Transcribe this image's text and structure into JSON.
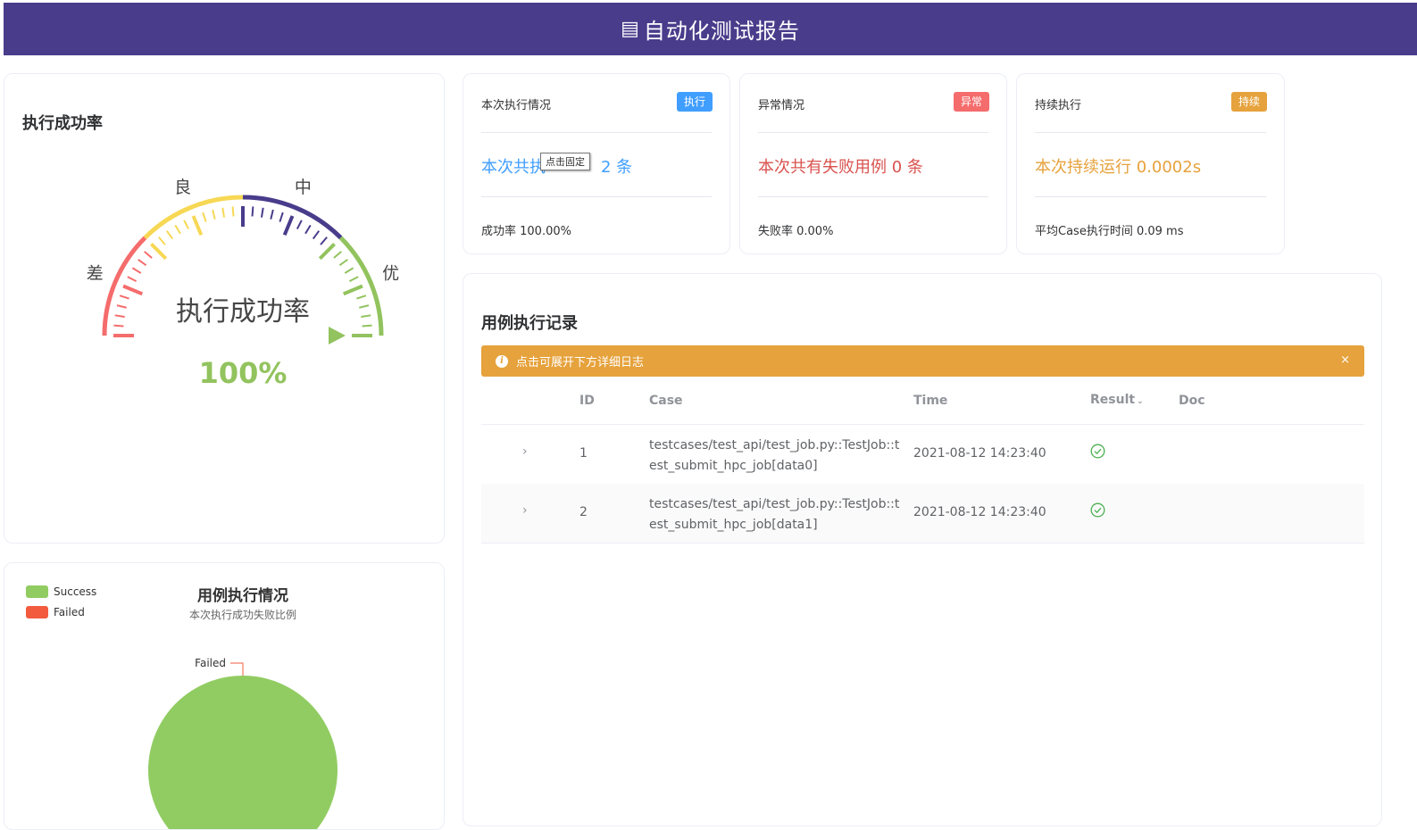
{
  "header": {
    "title": "自动化测试报告",
    "icon": "report-icon"
  },
  "gauge_card": {
    "title": "执行成功率",
    "center_label": "执行成功率",
    "value_text": "100%",
    "value_fraction": 1.0,
    "zones": {
      "poor": "差",
      "good": "良",
      "medium": "中",
      "excellent": "优"
    },
    "colors": {
      "poor": "#f56c6c",
      "good": "#f7d854",
      "medium": "#493c8b",
      "excellent": "#92c35e"
    }
  },
  "stats": [
    {
      "head": "本次执行情况",
      "tag": "执行",
      "tag_color": "#409eff",
      "main": "本次共执行用例 2 条",
      "main_visible_start": "本次共执",
      "main_visible_end": "2 条",
      "main_color": "#409eff",
      "foot": "成功率 100.00%"
    },
    {
      "head": "异常情况",
      "tag": "异常",
      "tag_color": "#f56c6c",
      "main": "本次共有失败用例 0 条",
      "main_color": "#d9534f",
      "foot": "失败率 0.00%"
    },
    {
      "head": "持续执行",
      "tag": "持续",
      "tag_color": "#e6a23c",
      "main": "本次持续运行 0.0002s",
      "main_color": "#e6a23c",
      "foot": "平均Case执行时间 0.09 ms"
    }
  ],
  "tooltip": "点击固定",
  "records": {
    "title": "用例执行记录",
    "alert": "点击可展开下方详细日志",
    "alert_close": "×",
    "columns": {
      "id": "ID",
      "case": "Case",
      "time": "Time",
      "result": "Result",
      "doc": "Doc"
    },
    "rows": [
      {
        "id": "1",
        "case": "testcases/test_api/test_job.py::TestJob::test_submit_hpc_job[data0]",
        "time": "2021-08-12 14:23:40",
        "result": "success"
      },
      {
        "id": "2",
        "case": "testcases/test_api/test_job.py::TestJob::test_submit_hpc_job[data1]",
        "time": "2021-08-12 14:23:40",
        "result": "success"
      }
    ]
  },
  "pie_card": {
    "title": "用例执行情况",
    "subtitle": "本次执行成功失败比例",
    "legend": [
      {
        "name": "Success",
        "color": "#91cc62"
      },
      {
        "name": "Failed",
        "color": "#f35b3e"
      }
    ],
    "slice_label": "Failed",
    "chart_data": {
      "type": "pie",
      "title": "用例执行情况",
      "subtitle": "本次执行成功失败比例",
      "categories": [
        "Success",
        "Failed"
      ],
      "values": [
        2,
        0
      ]
    }
  }
}
